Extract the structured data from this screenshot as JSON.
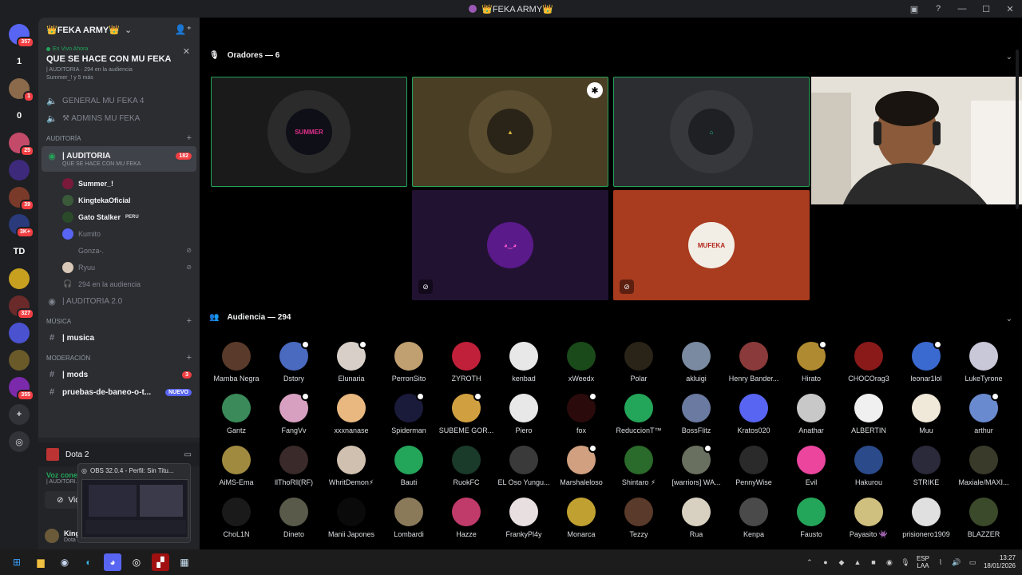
{
  "window": {
    "title": "👑FEKA ARMY👑"
  },
  "rail": {
    "items": [
      {
        "label": "",
        "badge": "357",
        "color": "#5865f2",
        "icon": "discord-home-icon"
      },
      {
        "label": "1",
        "badge": "",
        "color": "#1e1f22"
      },
      {
        "label": "",
        "badge": "1",
        "color": "#8a6a4a"
      },
      {
        "label": "0",
        "badge": "",
        "color": "#1e1f22"
      },
      {
        "label": "",
        "badge": "25",
        "color": "#c44a6a"
      },
      {
        "label": "",
        "badge": "",
        "color": "#3d2a7a"
      },
      {
        "label": "",
        "badge": "39",
        "color": "#7a3a2a"
      },
      {
        "label": "",
        "badge": "3K+",
        "color": "#2a3a7a"
      },
      {
        "label": "TD",
        "badge": "",
        "color": "#1e1f22"
      },
      {
        "label": "",
        "badge": "",
        "color": "#c8a020"
      },
      {
        "label": "",
        "badge": "327",
        "color": "#6a2a2a"
      },
      {
        "label": "",
        "badge": "",
        "color": "#4a52d0"
      },
      {
        "label": "",
        "badge": "",
        "color": "#6a5a2a"
      },
      {
        "label": "",
        "badge": "355",
        "color": "#7a2aaa"
      }
    ]
  },
  "sidebar": {
    "server_name": "👑FEKA ARMY👑",
    "live": {
      "tag": "En Vivo Ahora",
      "title": "QUE SE HACE CON MU FEKA",
      "meta": "| AUDITORIA · 294 en la audiencia",
      "meta2": "Summer_! y 5 más"
    },
    "channels_top": [
      {
        "label": "GENERAL MU FEKA 4"
      },
      {
        "label": "⚒ ADMINS MU FEKA"
      }
    ],
    "cat_auditoria": "AUDITORÍA",
    "active_channel": {
      "label": "| AUDITORIA",
      "sub": "QUE SE HACE CON MU FEKA",
      "badge": "182"
    },
    "voice_users": [
      {
        "name": "Summer_!",
        "dim": false,
        "color": "#7a1a3a",
        "flag": ""
      },
      {
        "name": "KingtekaOficial",
        "dim": false,
        "color": "#3a5a3a",
        "flag": ""
      },
      {
        "name": "Gato Stalker",
        "dim": false,
        "color": "#2a4a2a",
        "flag": "PERU"
      },
      {
        "name": "Kumito",
        "dim": true,
        "color": "#5865f2",
        "flag": ""
      },
      {
        "name": "Gonza-.",
        "dim": true,
        "color": "#2b2d31",
        "flag": ""
      },
      {
        "name": "Ryuu",
        "dim": true,
        "color": "#d8c8b8",
        "flag": ""
      }
    ],
    "audience_line": "294 en la audiencia",
    "auditoria2": "| AUDITORIA 2.0",
    "cat_musica": "MÚSICA",
    "musica": "| musica",
    "cat_moderacion": "MODERACIÓN",
    "mods": "| mods",
    "mods_badge": "3",
    "pruebas": "pruebas-de-baneo-o-t...",
    "pruebas_badge": "NUEVO"
  },
  "voicepanel": {
    "game": "Dota 2",
    "vc_status": "Voz conecta...",
    "vc_sub": "| AUDITORI...",
    "video_label": "Video",
    "user_name": "KingtekaOfic...",
    "user_sub": "Dota 2 +1"
  },
  "obs": {
    "title": "OBS 32.0.4 - Perfil: Sin Titu..."
  },
  "stage": {
    "speakers_label": "Oradores — 6",
    "audience_label": "Audiencia — 294",
    "tiles": [
      {
        "name": "summer",
        "text": "SUMMER",
        "bg": "#1a1a1a",
        "ring": "#2b2b2b",
        "circ": "#0f0f18",
        "fg": "#e0308a",
        "speaking": true,
        "muted": false,
        "badge": false
      },
      {
        "name": "illuminati",
        "text": "▲",
        "bg": "#4a3e25",
        "ring": "#5a4d30",
        "circ": "#2a2418",
        "fg": "#d4b040",
        "speaking": true,
        "muted": false,
        "badge": true
      },
      {
        "name": "green-house",
        "text": "⌂",
        "bg": "#2b2d31",
        "ring": "#36383c",
        "circ": "#1e2024",
        "fg": "#2ac08a",
        "speaking": true,
        "muted": false,
        "badge": false
      },
      {
        "name": "purple-ghost",
        "text": "◕‿◕",
        "bg": "#221232",
        "ring": "#221232",
        "circ": "#5a1a8a",
        "fg": "#ff5acd",
        "speaking": false,
        "muted": true,
        "badge": false
      },
      {
        "name": "mufeka",
        "text": "MUFEKA",
        "bg": "#a93b1e",
        "ring": "#a93b1e",
        "circ": "#f2ede5",
        "fg": "#b3241a",
        "speaking": false,
        "muted": true,
        "badge": false
      }
    ],
    "audience": [
      {
        "name": "Mamba Negra",
        "color": "#5a3a2a",
        "status": false
      },
      {
        "name": "Dstory",
        "color": "#4a6ac0",
        "status": true
      },
      {
        "name": "Elunaria",
        "color": "#d8d0c8",
        "status": true
      },
      {
        "name": "PerronSito",
        "color": "#c0a070",
        "status": false
      },
      {
        "name": "ZYROTH",
        "color": "#c0203a",
        "status": false
      },
      {
        "name": "kenbad",
        "color": "#e8e8e8",
        "status": false
      },
      {
        "name": "xWeedx",
        "color": "#1a4a1a",
        "status": false
      },
      {
        "name": "Polar",
        "color": "#2a2418",
        "status": false
      },
      {
        "name": "akluigi",
        "color": "#7a8aa0",
        "status": false
      },
      {
        "name": "Henry Bander...",
        "color": "#8a3a3a",
        "status": false
      },
      {
        "name": "Hirato",
        "color": "#b08a30",
        "status": true
      },
      {
        "name": "CHOCOrag3",
        "color": "#8a1a1a",
        "status": false
      },
      {
        "name": "leonar1lol",
        "color": "#3a6ad0",
        "status": true
      },
      {
        "name": "LukeTyrone",
        "color": "#c8c8d8",
        "status": false
      },
      {
        "name": "Gantz",
        "color": "#3a8a5a",
        "status": false
      },
      {
        "name": "FangVv",
        "color": "#d8a0c0",
        "status": true
      },
      {
        "name": "xxxnanase",
        "color": "#e8b880",
        "status": false
      },
      {
        "name": "Spiderman",
        "color": "#1a1a3a",
        "status": true
      },
      {
        "name": "SUBEME GOR...",
        "color": "#d0a040",
        "status": true
      },
      {
        "name": "Piero",
        "color": "#e8e8e8",
        "status": false
      },
      {
        "name": "fox",
        "color": "#2a0a0a",
        "status": true
      },
      {
        "name": "ReduccionT™",
        "color": "#23a55a",
        "status": false
      },
      {
        "name": "BossFlitz",
        "color": "#6a7aa0",
        "status": false
      },
      {
        "name": "Kratos020",
        "color": "#5865f2",
        "status": false
      },
      {
        "name": "Anathar",
        "color": "#c8c8c8",
        "status": false
      },
      {
        "name": "ALBERTIN",
        "color": "#f0f0f0",
        "status": false
      },
      {
        "name": "Muu",
        "color": "#f0e8d8",
        "status": false
      },
      {
        "name": "arthur",
        "color": "#6a8ad0",
        "status": true
      },
      {
        "name": "AiMS-Ema",
        "color": "#a08a40",
        "status": false
      },
      {
        "name": "llThoRll(RF)",
        "color": "#3a2a2a",
        "status": false
      },
      {
        "name": "WhritDemon⚡",
        "color": "#d0c0b0",
        "status": false
      },
      {
        "name": "Bauti",
        "color": "#23a55a",
        "status": false
      },
      {
        "name": "RuokFC",
        "color": "#1a3a2a",
        "status": false
      },
      {
        "name": "EL Oso Yungu...",
        "color": "#3a3a3a",
        "status": false
      },
      {
        "name": "Marshaleloso",
        "color": "#d0a080",
        "status": true
      },
      {
        "name": "Shintaro ⚡",
        "color": "#2a6a2a",
        "status": false
      },
      {
        "name": "[warriors] WA...",
        "color": "#6a7060",
        "status": true
      },
      {
        "name": "PennyWise",
        "color": "#2a2a2a",
        "status": false
      },
      {
        "name": "Evil",
        "color": "#eb459e",
        "status": false
      },
      {
        "name": "Hakurou",
        "color": "#2a4a8a",
        "status": false
      },
      {
        "name": "STRIKE",
        "color": "#2a2a3a",
        "status": false
      },
      {
        "name": "Maxiale/MAXI...",
        "color": "#3a3a2a",
        "status": false
      },
      {
        "name": "ChoL1N",
        "color": "#1a1a1a",
        "status": false
      },
      {
        "name": "Dineto",
        "color": "#5a5a4a",
        "status": false
      },
      {
        "name": "Manii Japones",
        "color": "#0a0a0a",
        "status": false
      },
      {
        "name": "Lombardi",
        "color": "#8a7a5a",
        "status": false
      },
      {
        "name": "Hazze",
        "color": "#c03a6a",
        "status": false
      },
      {
        "name": "FrankyPl4y",
        "color": "#e8e0e0",
        "status": false
      },
      {
        "name": "Monarca",
        "color": "#c0a030",
        "status": false
      },
      {
        "name": "Tezzy",
        "color": "#5a3a2a",
        "status": false
      },
      {
        "name": "Rua",
        "color": "#d8d0c0",
        "status": false
      },
      {
        "name": "Kenpa",
        "color": "#4a4a4a",
        "status": false
      },
      {
        "name": "Fausto",
        "color": "#23a55a",
        "status": false
      },
      {
        "name": "Payasito 👾",
        "color": "#d0c080",
        "status": false
      },
      {
        "name": "prisionero1909",
        "color": "#e0e0e0",
        "status": false
      },
      {
        "name": "BLAZZER",
        "color": "#3a4a2a",
        "status": false
      }
    ]
  },
  "taskbar": {
    "lang1": "ESP",
    "lang2": "LAA",
    "time": "13:27",
    "date": "18/01/2026"
  }
}
